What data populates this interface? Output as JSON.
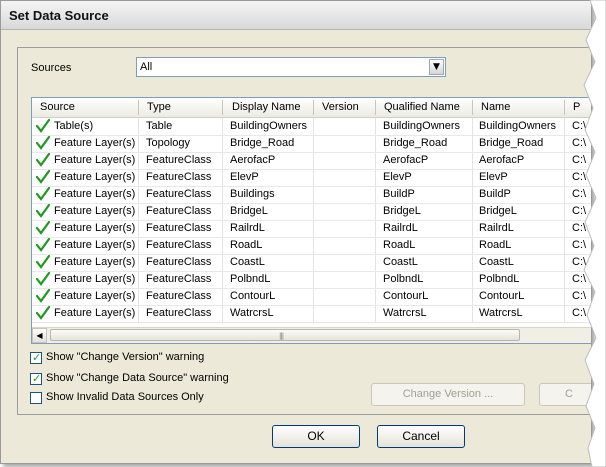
{
  "window": {
    "title": "Set Data Source"
  },
  "sources": {
    "label": "Sources",
    "selected": "All"
  },
  "grid": {
    "columns": [
      "Source",
      "Type",
      "Display Name",
      "Version",
      "Qualified Name",
      "Name",
      "P"
    ],
    "rows": [
      {
        "source": "Table(s)",
        "type": "Table",
        "display": "BuildingOwners",
        "version": "",
        "qualified": "BuildingOwners",
        "name": "BuildingOwners",
        "path": "C:\\"
      },
      {
        "source": "Feature Layer(s)",
        "type": "Topology",
        "display": "Bridge_Road",
        "version": "",
        "qualified": "Bridge_Road",
        "name": "Bridge_Road",
        "path": "C:\\"
      },
      {
        "source": "Feature Layer(s)",
        "type": "FeatureClass",
        "display": "AerofacP",
        "version": "",
        "qualified": "AerofacP",
        "name": "AerofacP",
        "path": "C:\\"
      },
      {
        "source": "Feature Layer(s)",
        "type": "FeatureClass",
        "display": "ElevP",
        "version": "",
        "qualified": "ElevP",
        "name": "ElevP",
        "path": "C:\\"
      },
      {
        "source": "Feature Layer(s)",
        "type": "FeatureClass",
        "display": "Buildings",
        "version": "",
        "qualified": "BuildP",
        "name": "BuildP",
        "path": "C:\\"
      },
      {
        "source": "Feature Layer(s)",
        "type": "FeatureClass",
        "display": "BridgeL",
        "version": "",
        "qualified": "BridgeL",
        "name": "BridgeL",
        "path": "C:\\"
      },
      {
        "source": "Feature Layer(s)",
        "type": "FeatureClass",
        "display": "RailrdL",
        "version": "",
        "qualified": "RailrdL",
        "name": "RailrdL",
        "path": "C:\\"
      },
      {
        "source": "Feature Layer(s)",
        "type": "FeatureClass",
        "display": "RoadL",
        "version": "",
        "qualified": "RoadL",
        "name": "RoadL",
        "path": "C:\\"
      },
      {
        "source": "Feature Layer(s)",
        "type": "FeatureClass",
        "display": "CoastL",
        "version": "",
        "qualified": "CoastL",
        "name": "CoastL",
        "path": "C:\\"
      },
      {
        "source": "Feature Layer(s)",
        "type": "FeatureClass",
        "display": "PolbndL",
        "version": "",
        "qualified": "PolbndL",
        "name": "PolbndL",
        "path": "C:\\"
      },
      {
        "source": "Feature Layer(s)",
        "type": "FeatureClass",
        "display": "ContourL",
        "version": "",
        "qualified": "ContourL",
        "name": "ContourL",
        "path": "C:\\"
      },
      {
        "source": "Feature Layer(s)",
        "type": "FeatureClass",
        "display": "WatrcrsL",
        "version": "",
        "qualified": "WatrcrsL",
        "name": "WatrcrsL",
        "path": "C:\\"
      }
    ]
  },
  "options": {
    "change_version_warning": {
      "label": "Show \"Change Version\" warning",
      "checked": true
    },
    "change_source_warning": {
      "label": "Show \"Change Data Source\" warning",
      "checked": true
    },
    "invalid_only": {
      "label": "Show Invalid Data Sources Only",
      "checked": false
    }
  },
  "buttons": {
    "change_version": "Change Version ...",
    "change_source": "C",
    "ok": "OK",
    "cancel": "Cancel"
  },
  "icons": {
    "valid": "green-check-icon",
    "dropdown": "chevron-down-icon"
  },
  "colors": {
    "check": "#1f9a1f",
    "accent": "#7f9db9"
  }
}
